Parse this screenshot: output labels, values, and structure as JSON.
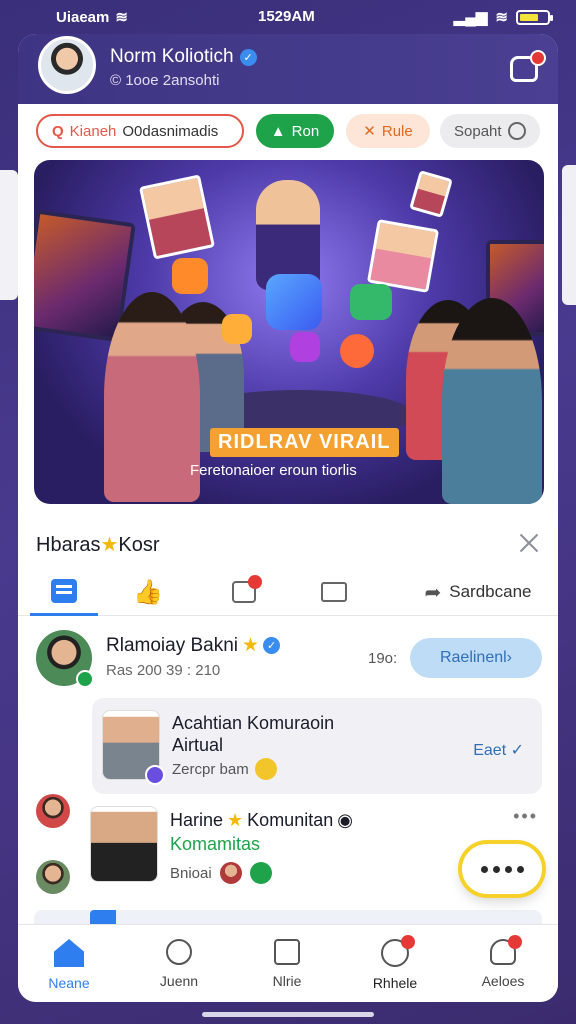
{
  "status_bar": {
    "carrier": "Uiaeam",
    "time": "1529AM"
  },
  "profile": {
    "name": "Norm Koliotich",
    "subtitle": "© 1ooe 2ansohti"
  },
  "filters": {
    "search_label": "Kianeh",
    "search_text": "O0dasnimadis",
    "run_label": "Ron",
    "rule_label": "Rule",
    "sort_label": "Sopaht"
  },
  "banner": {
    "title": "RIDLRAV VIRAIL",
    "subtitle": "Feretonaioer eroun tiorlis"
  },
  "sheet": {
    "title": "Hbaras",
    "title_suffix": "Kosr",
    "share_label": "Sardbcane"
  },
  "feed": {
    "item1": {
      "name": "Rlamoiay Bakni",
      "meta": "Ras 200 39 : 210",
      "time": "19o:",
      "action": "Raelinenl›"
    },
    "item2": {
      "title": "Acahtian Komuraoin Airtual",
      "sub": "Zercpr bam",
      "edit": "Eaet ✓"
    },
    "item3": {
      "title": "Harine",
      "title_suffix": "Komunitan",
      "subtitle": "Komamitas",
      "meta": "Bnioai"
    }
  },
  "nav": {
    "home": "Neane",
    "search": "Juenn",
    "list": "Nlrie",
    "profile": "Rhhele",
    "account": "Aeloes"
  },
  "colors": {
    "accent": "#2f7ef0",
    "header": "#3d3583",
    "success": "#1ea34a",
    "alert": "#e53935"
  }
}
